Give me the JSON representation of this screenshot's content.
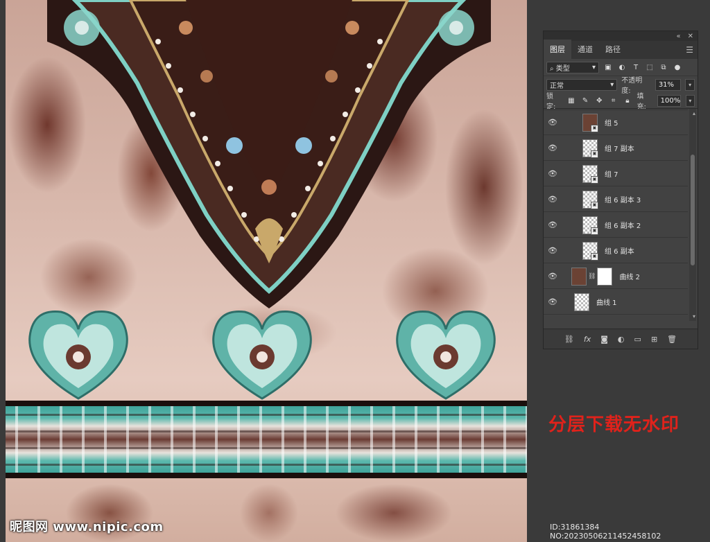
{
  "panel": {
    "tabs": [
      {
        "label": "图层",
        "active": true
      },
      {
        "label": "通道",
        "active": false
      },
      {
        "label": "路径",
        "active": false
      }
    ],
    "filter": {
      "kind": "类型"
    },
    "blend_mode": "正常",
    "opacity_label": "不透明度:",
    "opacity_value": "31%",
    "lock_label": "锁定:",
    "fill_label": "填充:",
    "fill_value": "100%",
    "layers": [
      {
        "name": "组 5",
        "thumb": "dark"
      },
      {
        "name": "组 7 副本",
        "thumb": "transparent"
      },
      {
        "name": "组 7",
        "thumb": "transparent"
      },
      {
        "name": "组 6 副本 3",
        "thumb": "transparent"
      },
      {
        "name": "组 6 副本 2",
        "thumb": "transparent"
      },
      {
        "name": "组 6 副本",
        "thumb": "transparent"
      },
      {
        "name": "曲线 2",
        "thumb": "adjustment-with-mask"
      },
      {
        "name": "曲线 1",
        "thumb": "adjustment"
      }
    ]
  },
  "promo_text": "分层下载无水印",
  "id_text": "ID:31861384 NO:20230506211452458102",
  "site_watermark": "昵图网 www.nipic.com",
  "colors": {
    "panel_bg": "#424242",
    "promo": "#e0221b",
    "teal_accent": "#4fb0a6",
    "rust": "#6e2b1f"
  }
}
